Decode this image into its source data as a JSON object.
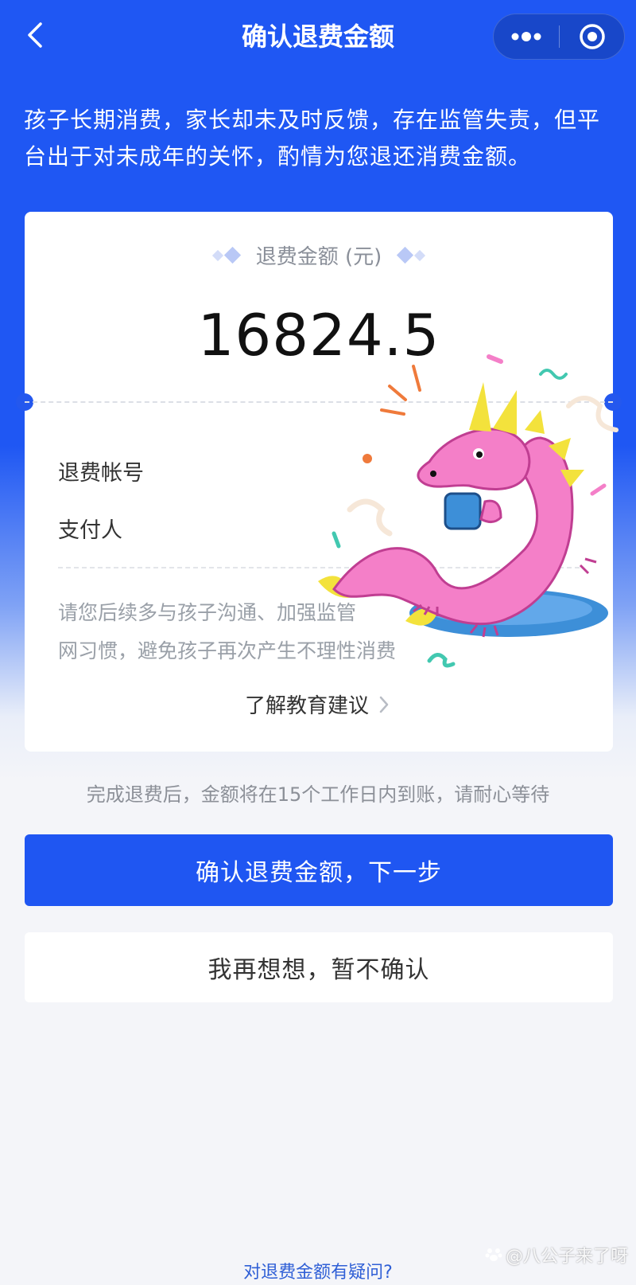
{
  "header": {
    "title": "确认退费金额",
    "back_icon": "chevron-left-icon",
    "more_icon": "more-dots-icon",
    "close_icon": "target-close-icon"
  },
  "notice": {
    "text": "孩子长期消费，家长却未及时反馈，存在监管失责，但平台出于对未成年的关怀，酌情为您退还消费金额。"
  },
  "card": {
    "amount_label": "退费金额 (元)",
    "amount": "16824.5",
    "account_label": "退费帐号",
    "payer_label": "支付人",
    "advice_line1": "请您后续多与孩子沟通、加强监管",
    "advice_line2": "网习惯，避免孩子再次产生不理性消费",
    "edu_link": "了解教育建议"
  },
  "hint": "完成退费后，金额将在15个工作日内到账，请耐心等待",
  "buttons": {
    "confirm": "确认退费金额，下一步",
    "cancel": "我再想想，暂不确认"
  },
  "footer": {
    "question_link": "对退费金额有疑问?"
  },
  "watermark": {
    "text": "@八公子来了呀"
  },
  "colors": {
    "primary": "#1f56f2",
    "background": "#f4f5f9",
    "sticker_pink": "#f47fc8",
    "sticker_yellow": "#f3e23c",
    "sticker_blue": "#3d8fd8"
  }
}
